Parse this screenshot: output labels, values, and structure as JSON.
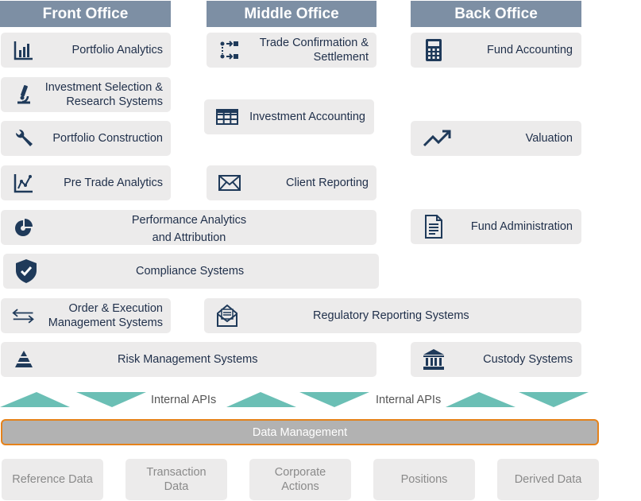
{
  "headers": {
    "front": "Front Office",
    "middle": "Middle Office",
    "back": "Back Office"
  },
  "boxes": {
    "portfolio_analytics": "Portfolio Analytics",
    "investment_selection": [
      "Investment Selection &",
      "Research Systems"
    ],
    "portfolio_construction": "Portfolio Construction",
    "pre_trade_analytics": "Pre Trade Analytics",
    "performance_analytics": [
      "Performance Analytics",
      "and Attribution"
    ],
    "compliance_systems": "Compliance Systems",
    "order_execution": [
      "Order & Execution",
      "Management Systems"
    ],
    "risk_management": "Risk Management Systems",
    "trade_confirmation": [
      "Trade Confirmation &",
      "Settlement"
    ],
    "investment_accounting": "Investment Accounting",
    "client_reporting": "Client Reporting",
    "regulatory_reporting": "Regulatory Reporting Systems",
    "fund_accounting": "Fund Accounting",
    "valuation": "Valuation",
    "fund_administration": "Fund Administration",
    "custody_systems": "Custody Systems"
  },
  "apis": {
    "left": "Internal APIs",
    "right": "Internal APIs"
  },
  "data_management": "Data Management",
  "sources": {
    "reference": "Reference Data",
    "transaction": [
      "Transaction",
      "Data"
    ],
    "corporate": [
      "Corporate",
      "Actions"
    ],
    "positions": "Positions",
    "derived": "Derived Data"
  },
  "colors": {
    "header_bg": "#7d8fa4",
    "box_bg": "#ecebeb",
    "icon": "#1f3a5a",
    "arrow": "#6bbfb5",
    "data_border": "#e5821a"
  }
}
